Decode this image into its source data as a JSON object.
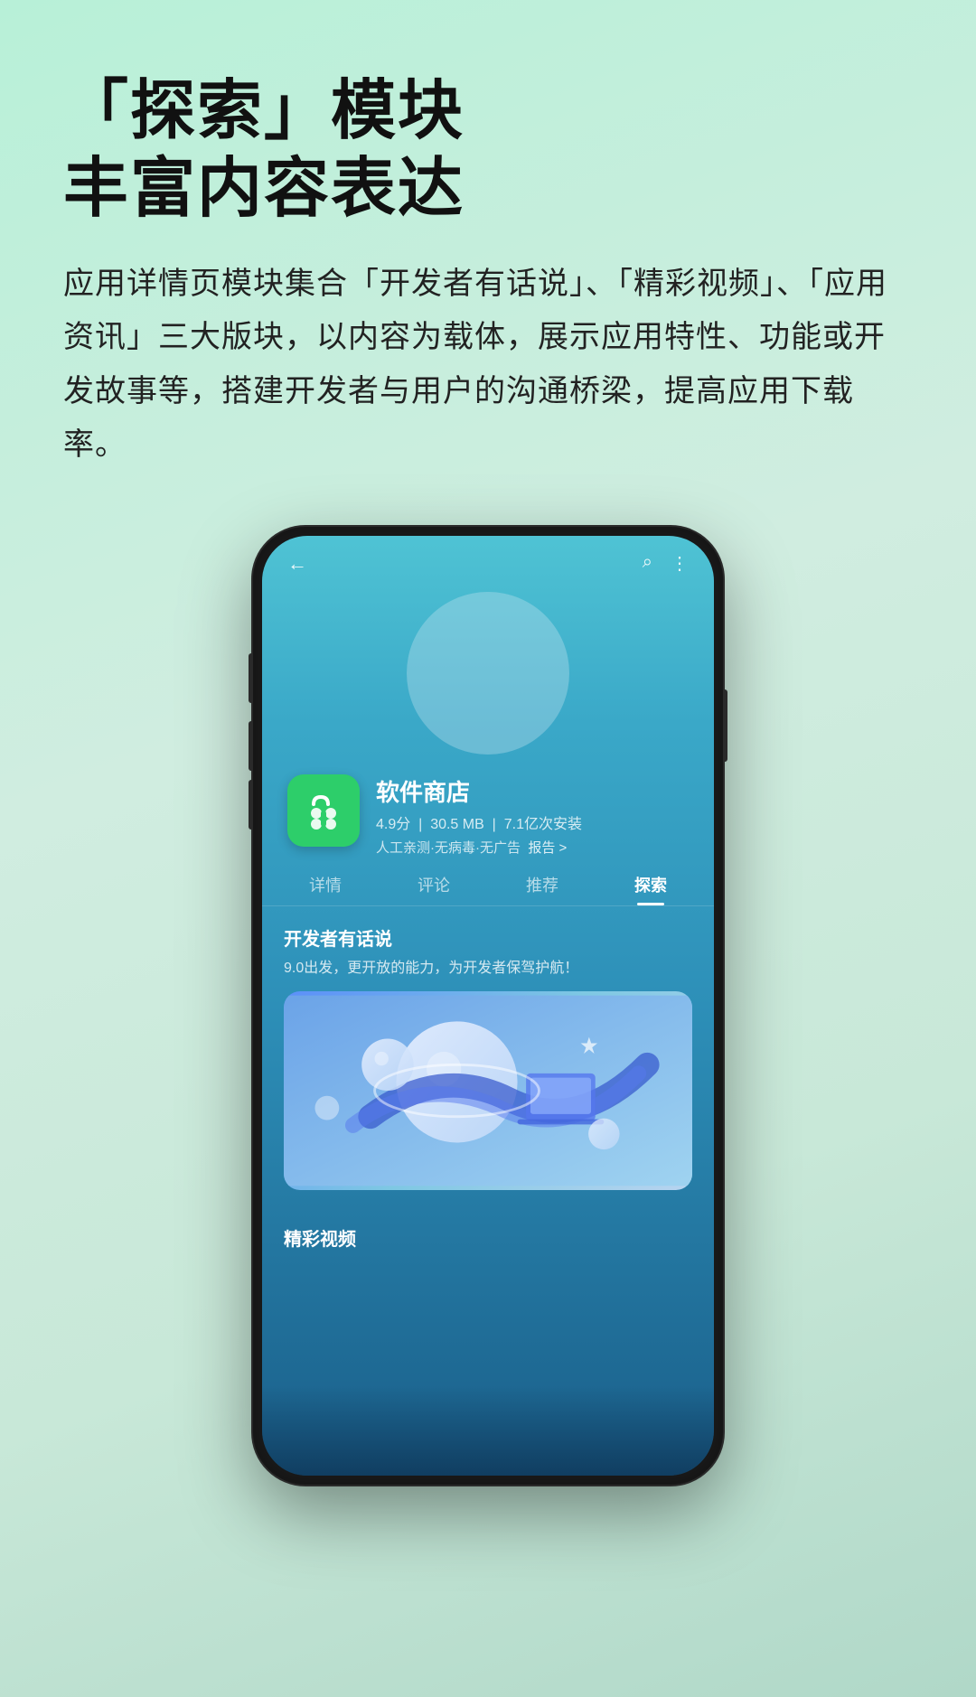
{
  "background": {
    "gradient_start": "#b8f0d8",
    "gradient_end": "#b0d8c8"
  },
  "headline": {
    "line1": "「探索」模块",
    "line2": "丰富内容表达"
  },
  "description": "应用详情页模块集合「开发者有话说」、「精彩视频」、「应用资讯」三大版块，以内容为载体，展示应用特性、功能或开发故事等，搭建开发者与用户的沟通桥梁，提高应用下载率。",
  "phone": {
    "topbar": {
      "back_icon": "←",
      "search_icon": "⌕",
      "more_icon": "⋮"
    },
    "app": {
      "name": "软件商店",
      "rating": "4.9分",
      "size": "30.5 MB",
      "installs": "7.1亿次安装",
      "tags": "人工亲测·无病毒·无广告",
      "report": "报告 >"
    },
    "nav_tabs": [
      {
        "label": "详情",
        "active": false
      },
      {
        "label": "评论",
        "active": false
      },
      {
        "label": "推荐",
        "active": false
      },
      {
        "label": "探索",
        "active": true
      }
    ],
    "developer_section": {
      "title": "开发者有话说",
      "subtitle": "9.0出发，更开放的能力，为开发者保驾护航！"
    },
    "highlight_section": {
      "title": "精彩视频"
    }
  }
}
